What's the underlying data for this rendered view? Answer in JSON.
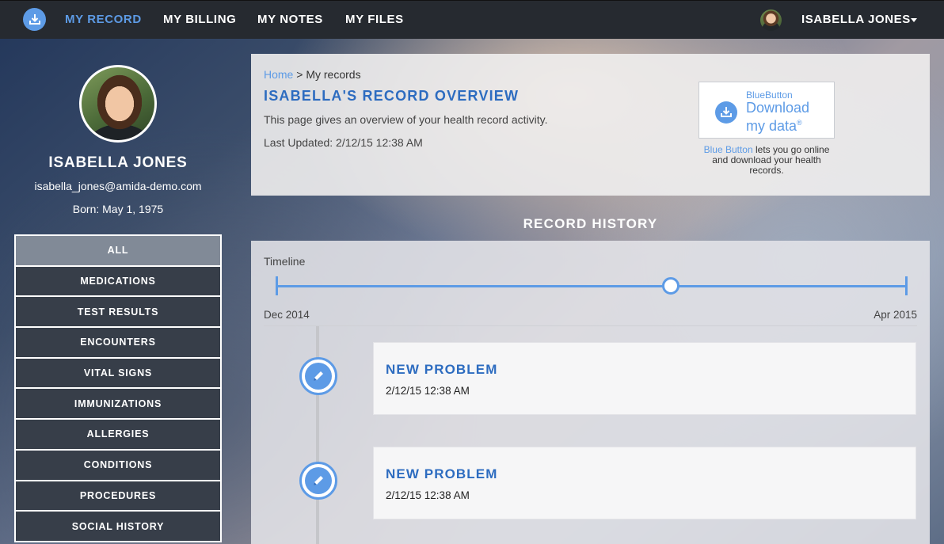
{
  "nav": {
    "logo_icon": "download-circle-icon",
    "links": [
      {
        "label": "MY RECORD",
        "active": true
      },
      {
        "label": "MY BILLING",
        "active": false
      },
      {
        "label": "MY NOTES",
        "active": false
      },
      {
        "label": "MY FILES",
        "active": false
      }
    ],
    "user_name": "ISABELLA JONES"
  },
  "profile": {
    "name": "ISABELLA JONES",
    "email": "isabella_jones@amida-demo.com",
    "born": "Born: May 1, 1975"
  },
  "menu": {
    "items": [
      {
        "label": "ALL",
        "active": true
      },
      {
        "label": "MEDICATIONS",
        "active": false
      },
      {
        "label": "TEST RESULTS",
        "active": false
      },
      {
        "label": "ENCOUNTERS",
        "active": false
      },
      {
        "label": "VITAL SIGNS",
        "active": false
      },
      {
        "label": "IMMUNIZATIONS",
        "active": false
      },
      {
        "label": "ALLERGIES",
        "active": false
      },
      {
        "label": "CONDITIONS",
        "active": false
      },
      {
        "label": "PROCEDURES",
        "active": false
      },
      {
        "label": "SOCIAL HISTORY",
        "active": false
      }
    ]
  },
  "overview": {
    "breadcrumb_home": "Home",
    "breadcrumb_sep": " > ",
    "breadcrumb_current": "My records",
    "title": "ISABELLA'S RECORD OVERVIEW",
    "description": "This page gives an overview of your health record activity.",
    "last_updated": "Last Updated: 2/12/15 12:38 AM",
    "bluebutton": {
      "small_label": "BlueButton",
      "big_line1": "Download",
      "big_line2": "my data",
      "reg_mark": "®",
      "caption_link": "Blue Button",
      "caption_rest": " lets you go online and download your health records."
    }
  },
  "history": {
    "title": "RECORD HISTORY",
    "timeline_label": "Timeline",
    "start_label": "Dec 2014",
    "end_label": "Apr 2015",
    "slider_position": 0.625,
    "events": [
      {
        "title": "NEW PROBLEM",
        "date": "2/12/15 12:38 AM",
        "icon": "pencil-icon"
      },
      {
        "title": "NEW PROBLEM",
        "date": "2/12/15 12:38 AM",
        "icon": "pencil-icon"
      }
    ]
  },
  "colors": {
    "accent": "#5d9be6",
    "title_blue": "#2d6cc0",
    "navbar": "#262a30"
  }
}
